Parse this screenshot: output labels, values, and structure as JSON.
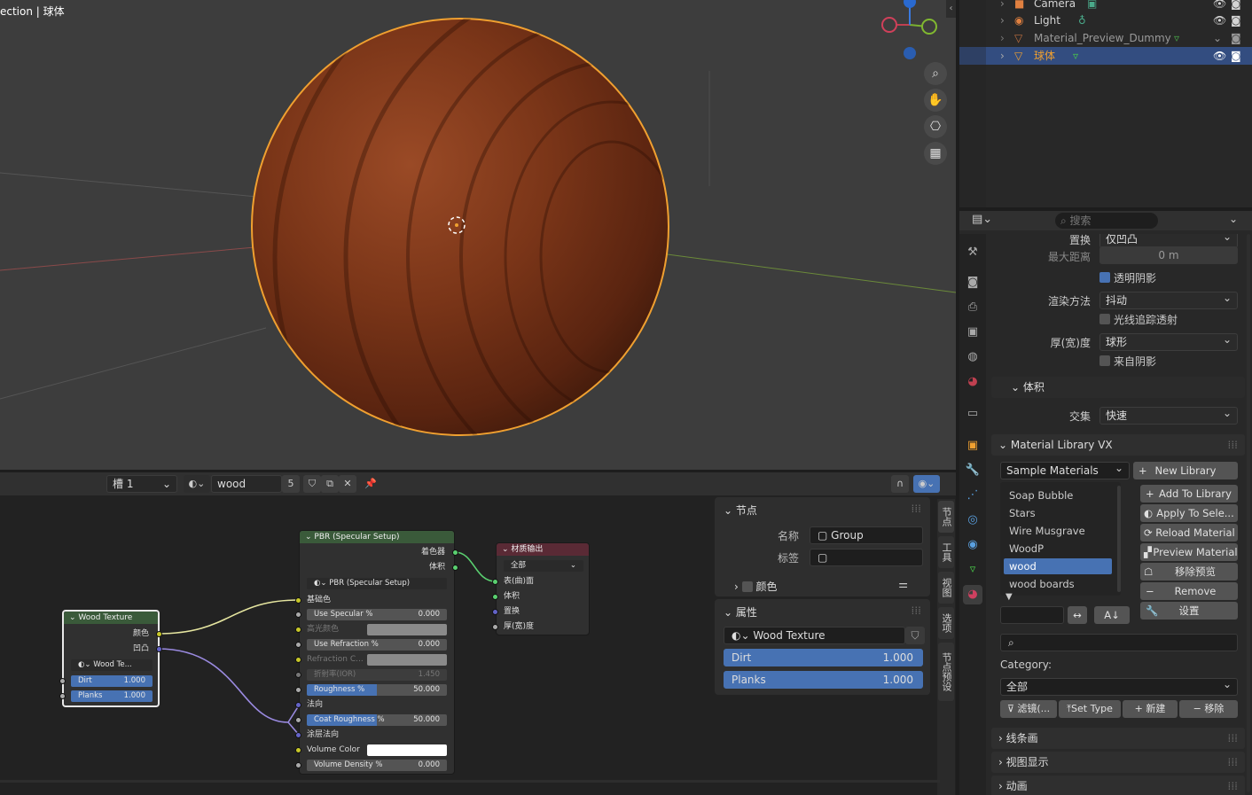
{
  "viewport": {
    "title": "ection | 球体",
    "nav_icons": [
      "zoom-icon",
      "hand-icon",
      "camera-icon",
      "grid-icon"
    ]
  },
  "outliner": {
    "rows": [
      {
        "name": "Camera",
        "icon": "camera-icon",
        "selected": false
      },
      {
        "name": "Light",
        "icon": "light-icon",
        "selected": false
      },
      {
        "name": "Material_Preview_Dummy",
        "icon": "mesh-icon",
        "selected": false
      },
      {
        "name": "球体",
        "icon": "mesh-icon",
        "selected": true
      }
    ]
  },
  "node_header": {
    "slot": "槽 1",
    "material_name": "wood",
    "user_count": "5"
  },
  "nodes": {
    "wood_texture": {
      "title": "Wood Texture",
      "out_color": "颜色",
      "out_bump": "凹凸",
      "group_name": "Wood Te...",
      "fields": [
        {
          "label": "Dirt",
          "value": "1.000"
        },
        {
          "label": "Planks",
          "value": "1.000"
        }
      ]
    },
    "pbr": {
      "title": "PBR (Specular Setup)",
      "out_shader": "着色器",
      "out_volume": "体积",
      "group_name": "PBR (Specular Setup)",
      "base_color": "基础色",
      "rows": [
        {
          "label": "Use Specular %",
          "value": "0.000"
        },
        {
          "label": "高光颜色",
          "value": ""
        },
        {
          "label": "Use Refraction %",
          "value": "0.000"
        },
        {
          "label": "Refraction C...",
          "value": ""
        },
        {
          "label": "折射率(IOR)",
          "value": "1.450"
        },
        {
          "label": "Roughness %",
          "value": "50.000"
        },
        {
          "label": "法向",
          "value": ""
        },
        {
          "label": "Coat Roughness %",
          "value": "50.000"
        },
        {
          "label": "涂层法向",
          "value": ""
        },
        {
          "label": "Volume Color",
          "value": ""
        },
        {
          "label": "Volume Density %",
          "value": "0.000"
        }
      ]
    },
    "output": {
      "title": "材质输出",
      "target": "全部",
      "inputs": [
        "表(曲)面",
        "体积",
        "置换",
        "厚(宽)度"
      ]
    }
  },
  "sidebar": {
    "tabs": [
      "节点",
      "工具",
      "视图",
      "选项",
      "节点预设"
    ],
    "node_panel": {
      "title": "节点",
      "name_label": "名称",
      "name_value": "Group",
      "label_label": "标签",
      "color_label": "颜色"
    },
    "props_panel": {
      "title": "属性",
      "group": "Wood Texture",
      "fields": [
        {
          "label": "Dirt",
          "value": "1.000"
        },
        {
          "label": "Planks",
          "value": "1.000"
        }
      ]
    }
  },
  "properties": {
    "search_placeholder": "搜索",
    "rows": {
      "displacement_label": "置换",
      "displacement_value": "仅凹凸",
      "max_distance_label": "最大距离",
      "max_distance_value": "0 m",
      "transparent_shadow": "透明阴影",
      "render_method_label": "渲染方法",
      "render_method_value": "抖动",
      "raytrace_label": "光线追踪透射",
      "thickness_label": "厚(宽)度",
      "thickness_value": "球形",
      "from_shadow": "来自阴影",
      "volume_section": "体积",
      "intersection_label": "交集",
      "intersection_value": "快速"
    },
    "matlib": {
      "title": "Material Library VX",
      "library": "Sample Materials",
      "new_library": "New Library",
      "items": [
        "Soap Bubble",
        "Stars",
        "Wire Musgrave",
        "WoodP",
        "wood",
        "wood boards"
      ],
      "selected": "wood",
      "buttons": [
        "Add To Library",
        "Apply To Sele...",
        "Reload Material",
        "Preview Material",
        "移除预览",
        "Remove Material",
        "设置"
      ],
      "category_label": "Category:",
      "category_value": "全部",
      "bottom_buttons": [
        "滤镜(...",
        "Set Type",
        "新建",
        "移除"
      ]
    },
    "collapsed_sections": [
      "线条画",
      "视图显示",
      "动画"
    ]
  }
}
